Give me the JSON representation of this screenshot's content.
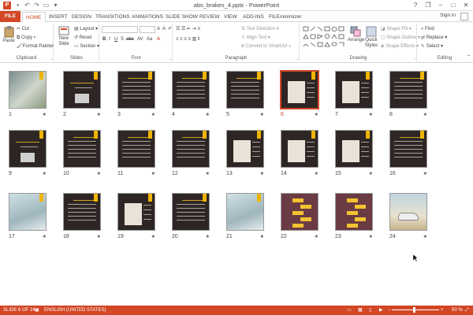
{
  "window": {
    "title": "abs_brakes_4.pptx - PowerPoint",
    "app_icon": "P"
  },
  "quick_access": [
    "save-icon",
    "undo-icon",
    "redo-icon",
    "present-icon",
    "customize-icon"
  ],
  "window_controls": {
    "help": "?",
    "restore": "❐",
    "minimize": "–",
    "maximize": "□",
    "close": "✕"
  },
  "tabs": [
    "FILE",
    "HOME",
    "INSERT",
    "DESIGN",
    "TRANSITIONS",
    "ANIMATIONS",
    "SLIDE SHOW",
    "REVIEW",
    "VIEW",
    "ADD-INS",
    "FILEminimizer"
  ],
  "active_tab": "HOME",
  "account": {
    "sign_in": "Sign in"
  },
  "ribbon": {
    "clipboard": {
      "label": "Clipboard",
      "paste": "Paste",
      "cut": "Cut",
      "copy": "Copy",
      "format_painter": "Format Painter"
    },
    "slides": {
      "label": "Slides",
      "new_slide": "New Slide",
      "layout": "Layout",
      "reset": "Reset",
      "section": "Section"
    },
    "font": {
      "label": "Font"
    },
    "paragraph": {
      "label": "Paragraph",
      "text_direction": "Text Direction",
      "align_text": "Align Text",
      "convert_smartart": "Convert to SmartArt"
    },
    "drawing": {
      "label": "Drawing",
      "arrange": "Arrange",
      "quick_styles": "Quick Styles",
      "shape_fill": "Shape Fill",
      "shape_outline": "Shape Outline",
      "shape_effects": "Shape Effects"
    },
    "editing": {
      "label": "Editing",
      "find": "Find",
      "replace": "Replace",
      "select": "Select"
    }
  },
  "slides": [
    {
      "n": "1",
      "star": "★",
      "style": "photo"
    },
    {
      "n": "2",
      "star": "★",
      "style": "title"
    },
    {
      "n": "3",
      "star": "★",
      "style": "text"
    },
    {
      "n": "4",
      "star": "★",
      "style": "text"
    },
    {
      "n": "5",
      "star": "★",
      "style": "text"
    },
    {
      "n": "6",
      "star": "★",
      "style": "figure"
    },
    {
      "n": "7",
      "star": "★",
      "style": "figure"
    },
    {
      "n": "8",
      "star": "★",
      "style": "text"
    },
    {
      "n": "9",
      "star": "★",
      "style": "title"
    },
    {
      "n": "10",
      "star": "★",
      "style": "text"
    },
    {
      "n": "11",
      "star": "★",
      "style": "text"
    },
    {
      "n": "12",
      "star": "★",
      "style": "text"
    },
    {
      "n": "13",
      "star": "★",
      "style": "figure"
    },
    {
      "n": "14",
      "star": "★",
      "style": "figure"
    },
    {
      "n": "15",
      "star": "★",
      "style": "figure"
    },
    {
      "n": "16",
      "star": "★",
      "style": "text"
    },
    {
      "n": "17",
      "star": "★",
      "style": "photo"
    },
    {
      "n": "18",
      "star": "★",
      "style": "text"
    },
    {
      "n": "19",
      "star": "★",
      "style": "figure"
    },
    {
      "n": "20",
      "star": "★",
      "style": "text"
    },
    {
      "n": "21",
      "star": "★",
      "style": "photo"
    },
    {
      "n": "22",
      "star": "★",
      "style": "diagram"
    },
    {
      "n": "23",
      "star": "★",
      "style": "diagram"
    },
    {
      "n": "24",
      "star": "★",
      "style": "car"
    }
  ],
  "selected_slide": "6",
  "status": {
    "slide_info": "SLIDE 6 OF 24",
    "language": "ENGLISH (UNITED STATES)",
    "zoom": "50 %",
    "zoom_level": 0.5
  },
  "colors": {
    "accent": "#d24726",
    "slide_bg": "#2d2624",
    "slide_accent": "#f0b400",
    "diagram_bg": "#6b3b44"
  }
}
